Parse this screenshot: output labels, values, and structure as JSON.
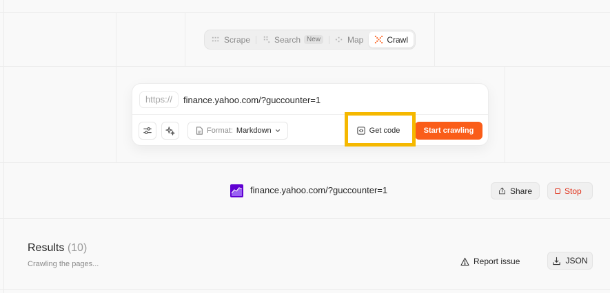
{
  "modes": {
    "scrape": "Scrape",
    "search": "Search",
    "search_badge": "New",
    "map": "Map",
    "crawl": "Crawl",
    "active": "crawl"
  },
  "crawl_form": {
    "protocol": "https://",
    "url_value": "finance.yahoo.com/?guccounter=1",
    "format_label": "Format:",
    "format_value": "Markdown",
    "get_code_label": "Get code",
    "start_label": "Start crawling"
  },
  "crawl_job": {
    "url": "finance.yahoo.com/?guccounter=1",
    "share_label": "Share",
    "stop_label": "Stop"
  },
  "results": {
    "title": "Results",
    "count": "(10)",
    "status": "Crawling the pages...",
    "report_label": "Report issue",
    "json_label": "JSON"
  },
  "colors": {
    "accent": "#fa5d19",
    "highlight": "#f5b800",
    "stop": "#e0311a",
    "yahoo": "#6001d2"
  }
}
